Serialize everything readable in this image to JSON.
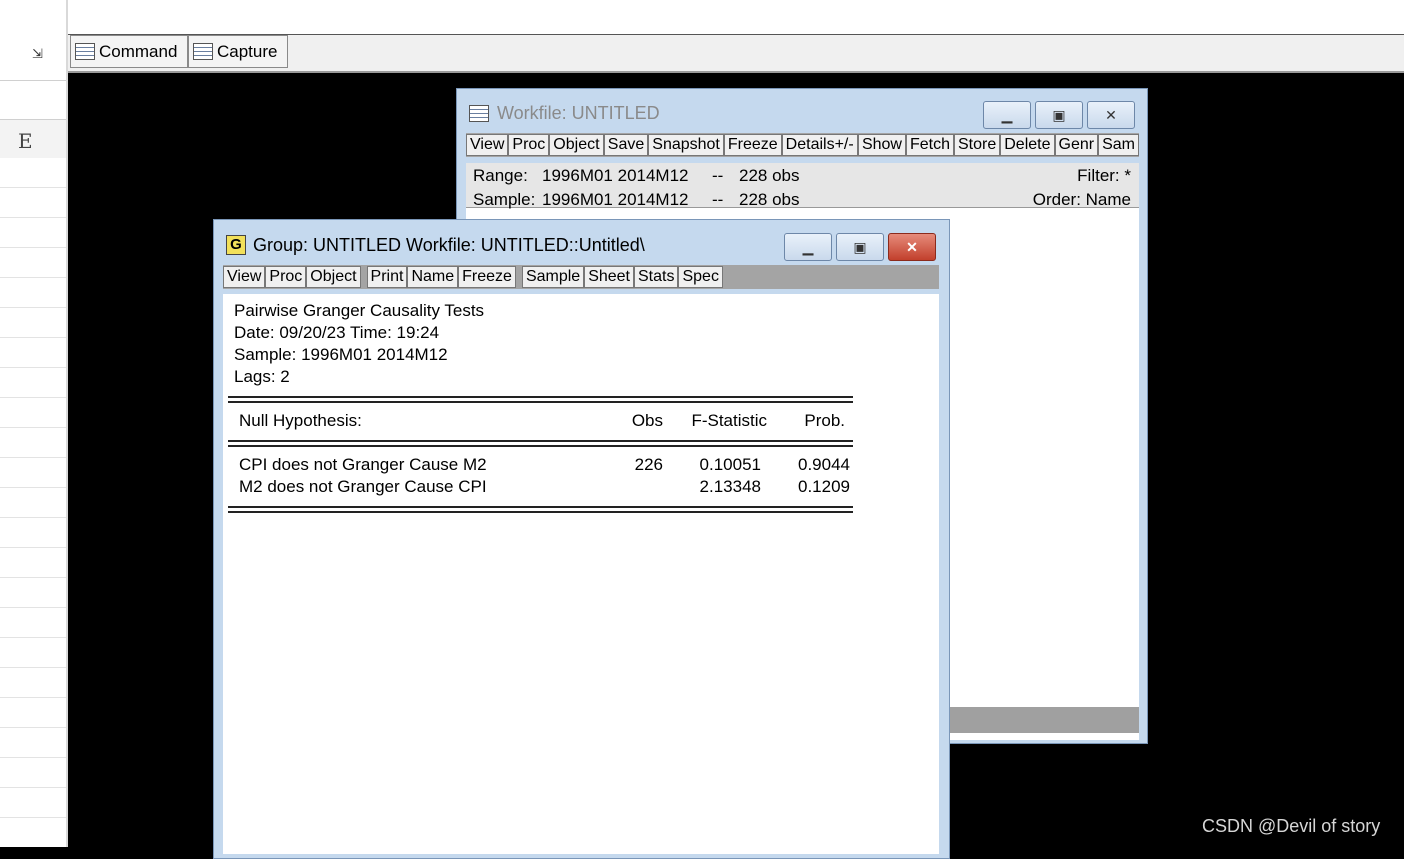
{
  "left_panel": {
    "column_header": "E"
  },
  "tabs": [
    {
      "label": "Command"
    },
    {
      "label": "Capture"
    }
  ],
  "workfile_window": {
    "title": "Workfile: UNTITLED",
    "toolbar": [
      "View",
      "Proc",
      "Object",
      "Save",
      "Snapshot",
      "Freeze",
      "Details+/-",
      "Show",
      "Fetch",
      "Store",
      "Delete",
      "Genr",
      "Sam"
    ],
    "range_label": "Range:",
    "range_value": "1996M01 2014M12",
    "range_sep": "--",
    "range_obs": "228 obs",
    "sample_label": "Sample:",
    "sample_value": "1996M01 2014M12",
    "sample_sep": "--",
    "sample_obs": "228 obs",
    "filter": "Filter: *",
    "order": "Order: Name"
  },
  "group_window": {
    "title_icon": "G",
    "title": "Group: UNTITLED   Workfile: UNTITLED::Untitled\\",
    "toolbar": [
      "View",
      "Proc",
      "Object",
      "Print",
      "Name",
      "Freeze",
      "Sample",
      "Sheet",
      "Stats",
      "Spec"
    ],
    "output": {
      "heading": "Pairwise Granger Causality Tests",
      "date_line": "Date: 09/20/23   Time: 19:24",
      "sample_line": "Sample: 1996M01 2014M12",
      "lags_line": "Lags: 2",
      "columns": {
        "hypothesis": "Null Hypothesis:",
        "obs": "Obs",
        "fstat": "F-Statistic",
        "prob": "Prob."
      },
      "rows": [
        {
          "hypothesis": "CPI does not Granger Cause M2",
          "obs": "226",
          "fstat": "0.10051",
          "prob": "0.9044"
        },
        {
          "hypothesis": "M2 does not Granger Cause CPI",
          "obs": "",
          "fstat": "2.13348",
          "prob": "0.1209"
        }
      ]
    }
  },
  "watermark": "CSDN @Devil of story"
}
